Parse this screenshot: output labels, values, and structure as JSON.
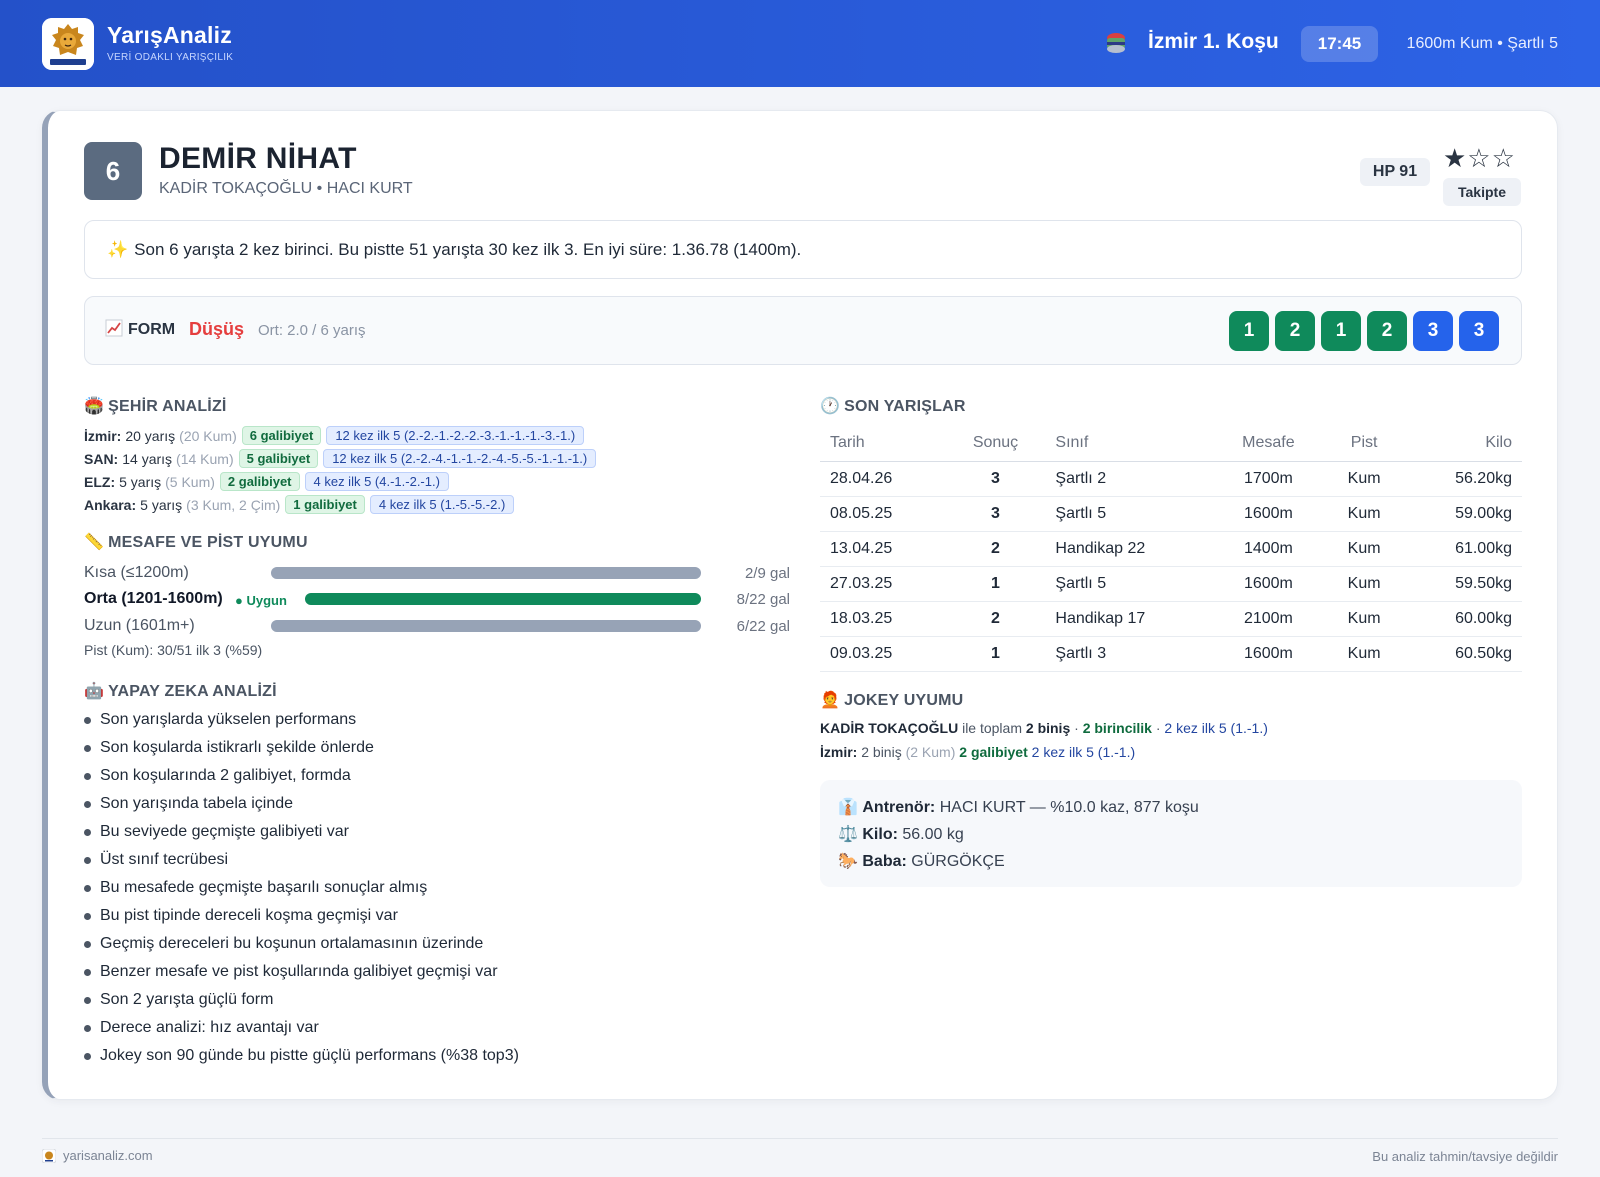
{
  "header": {
    "brand_name": "YarışAnaliz",
    "brand_tagline": "VERİ ODAKLI YARIŞÇILIK",
    "race_title": "İzmir 1. Koşu",
    "race_time": "17:45",
    "race_meta": "1600m Kum • Şartlı 5",
    "colors": {
      "bar_start": "#2451c9",
      "bar_end": "#2d63e6"
    }
  },
  "horse": {
    "number": "6",
    "name": "DEMİR NİHAT",
    "connections": "KADİR TOKAÇOĞLU • HACI KURT",
    "hp": "HP 91",
    "stars": "★☆☆",
    "rating_filled": 1,
    "rating_max": 3,
    "follow_label": "Takipte"
  },
  "summary": {
    "icon": "sparkles-icon",
    "text": "Son 6 yarışta 2 kez birinci. Bu pistte 51 yarışta 30 kez ilk 3. En iyi süre: 1.36.78 (1400m)."
  },
  "form": {
    "label": "FORM",
    "trend": "Düşüş",
    "average": "Ort: 2.0 / 6 yarış",
    "results": [
      "1",
      "2",
      "1",
      "2",
      "3",
      "3"
    ]
  },
  "city_analysis": {
    "title": "ŞEHİR ANALİZİ",
    "rows": [
      {
        "city": "İzmir:",
        "races": "20 yarış",
        "detail": "(20 Kum)",
        "wins": "6 galibiyet",
        "top5": "12 kez ilk 5 (2.-2.-1.-2.-2.-3.-1.-1.-1.-3.-1.)"
      },
      {
        "city": "SAN:",
        "races": "14 yarış",
        "detail": "(14 Kum)",
        "wins": "5 galibiyet",
        "top5": "12 kez ilk 5 (2.-2.-4.-1.-1.-2.-4.-5.-5.-1.-1.-1.)"
      },
      {
        "city": "ELZ:",
        "races": "5 yarış",
        "detail": "(5 Kum)",
        "wins": "2 galibiyet",
        "top5": "4 kez ilk 5 (4.-1.-2.-1.)"
      },
      {
        "city": "Ankara:",
        "races": "5 yarış",
        "detail": "(3 Kum, 2 Çim)",
        "wins": "1 galibiyet",
        "top5": "4 kez ilk 5 (1.-5.-5.-2.)"
      }
    ]
  },
  "distance_fit": {
    "title": "MESAFE VE PİST UYUMU",
    "rows": [
      {
        "label": "Kısa (≤1200m)",
        "value": "2/9 gal",
        "fill_pct": 100,
        "highlight": false,
        "badge": ""
      },
      {
        "label": "Orta (1201-1600m)",
        "value": "8/22 gal",
        "fill_pct": 100,
        "highlight": true,
        "badge": "Uygun"
      },
      {
        "label": "Uzun (1601m+)",
        "value": "6/22 gal",
        "fill_pct": 100,
        "highlight": false,
        "badge": ""
      }
    ],
    "pist_note": "Pist (Kum): 30/51 ilk 3 (%59)"
  },
  "ai_analysis": {
    "title": "YAPAY ZEKA ANALİZİ",
    "items": [
      "Son yarışlarda yükselen performans",
      "Son koşularda istikrarlı şekilde önlerde",
      "Son koşularında 2 galibiyet, formda",
      "Son yarışında tabela içinde",
      "Bu seviyede geçmişte galibiyeti var",
      "Üst sınıf tecrübesi",
      "Bu mesafede geçmişte başarılı sonuçlar almış",
      "Bu pist tipinde dereceli koşma geçmişi var",
      "Geçmiş dereceleri bu koşunun ortalamasının üzerinde",
      "Benzer mesafe ve pist koşullarında galibiyet geçmişi var",
      "Son 2 yarışta güçlü form",
      "Derece analizi: hız avantajı var",
      "Jokey son 90 günde bu pistte güçlü performans (%38 top3)"
    ]
  },
  "recent_races": {
    "title": "SON YARIŞLAR",
    "columns": [
      "Tarih",
      "Sonuç",
      "Sınıf",
      "Mesafe",
      "Pist",
      "Kilo"
    ],
    "rows": [
      [
        "28.04.26",
        "3",
        "Şartlı 2",
        "1700m",
        "Kum",
        "56.20kg"
      ],
      [
        "08.05.25",
        "3",
        "Şartlı 5",
        "1600m",
        "Kum",
        "59.00kg"
      ],
      [
        "13.04.25",
        "2",
        "Handikap 22",
        "1400m",
        "Kum",
        "61.00kg"
      ],
      [
        "27.03.25",
        "1",
        "Şartlı 5",
        "1600m",
        "Kum",
        "59.50kg"
      ],
      [
        "18.03.25",
        "2",
        "Handikap 17",
        "2100m",
        "Kum",
        "60.00kg"
      ],
      [
        "09.03.25",
        "1",
        "Şartlı 3",
        "1600m",
        "Kum",
        "60.50kg"
      ]
    ]
  },
  "jockey_fit": {
    "title": "JOKEY UYUMU",
    "line1": {
      "jockey": "KADİR TOKAÇOĞLU",
      "mid": " ile toplam ",
      "rides": "2 biniş",
      "sep1": " · ",
      "wins": "2 birincilik",
      "sep2": " · ",
      "top5": "2 kez ilk 5 (1.-1.)"
    },
    "line2": {
      "city": "İzmir:",
      "rides": " 2 biniş",
      "detail": " (2 Kum) ",
      "wins": "2 galibiyet",
      "top5": " 2 kez ilk 5 (1.-1.)"
    }
  },
  "info": {
    "trainer_label": "Antrenör:",
    "trainer_value": " HACI KURT — %10.0 kaz, 877 koşu",
    "weight_label": "Kilo:",
    "weight_value": " 56.00 kg",
    "sire_label": "Baba:",
    "sire_value": " GÜRGÖKÇE"
  },
  "footer": {
    "site": "yarisanaliz.com",
    "disclaimer": "Bu analiz tahmin/tavsiye değildir"
  }
}
